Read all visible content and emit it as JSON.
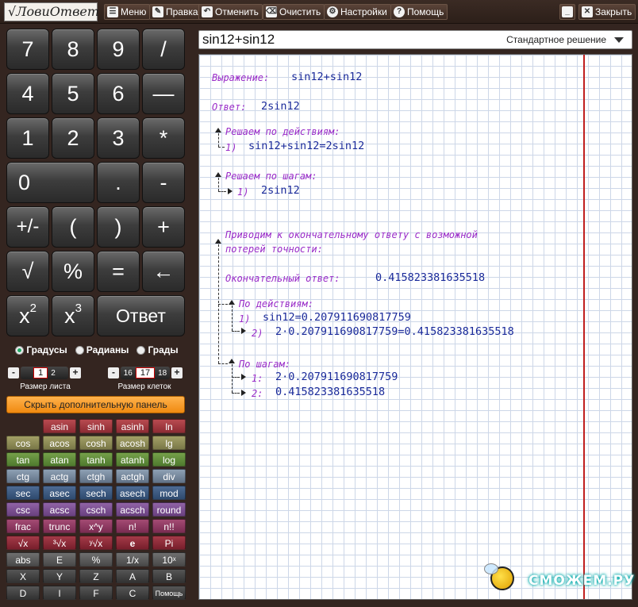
{
  "app": {
    "logo_text": "√ЛовиОтвет"
  },
  "toolbar": {
    "menu": "Меню",
    "edit": "Правка",
    "undo": "Отменить",
    "clear": "Очистить",
    "settings": "Настройки",
    "help": "Помощь",
    "close": "Закрыть"
  },
  "keypad": {
    "k7": "7",
    "k8": "8",
    "k9": "9",
    "kdiv": "/",
    "k4": "4",
    "k5": "5",
    "k6": "6",
    "kdash": "—",
    "k1": "1",
    "k2": "2",
    "k3": "3",
    "kmul": "*",
    "k0": "0",
    "kdot": ".",
    "kminus": "-",
    "kpm": "+/-",
    "klp": "(",
    "krp": ")",
    "kplus": "+",
    "ksqrt": "√",
    "kpct": "%",
    "keq": "=",
    "kback": "←",
    "kx": "x",
    "kx2sup": "2",
    "kx3sup": "3",
    "kanswer": "Ответ"
  },
  "angle_units": {
    "degrees": "Градусы",
    "radians": "Радианы",
    "grads": "Грады",
    "selected": "degrees"
  },
  "sheet_size": {
    "label": "Размер листа",
    "current": "1",
    "next": "2"
  },
  "cell_size": {
    "label": "Размер клеток",
    "prev": "16",
    "current": "17",
    "next": "18"
  },
  "hide_panel_button": "Скрыть дополнительную панель",
  "functions": {
    "asin": "asin",
    "sinh": "sinh",
    "asinh": "asinh",
    "ln": "ln",
    "cos": "cos",
    "acos": "acos",
    "cosh": "cosh",
    "acosh": "acosh",
    "lg": "lg",
    "tan": "tan",
    "atan": "atan",
    "tanh": "tanh",
    "atanh": "atanh",
    "log": "log",
    "ctg": "ctg",
    "actg": "actg",
    "ctgh": "ctgh",
    "actgh": "actgh",
    "div": "div",
    "sec": "sec",
    "asec": "asec",
    "sech": "sech",
    "asech": "asech",
    "mod": "mod",
    "csc": "csc",
    "acsc": "acsc",
    "csch": "csch",
    "acsch": "acsch",
    "round": "round",
    "frac": "frac",
    "trunc": "trunc",
    "xpowy": "x^y",
    "fact": "n!",
    "dfact": "n!!",
    "sqrtx": "√x",
    "cbrtx": "³√x",
    "yrootx": "ʸ√x",
    "e": "e",
    "pi": "Pi",
    "abs": "abs",
    "E": "E",
    "percent": "%",
    "inv": "1/x",
    "tenx": "10ˣ",
    "X": "X",
    "Y": "Y",
    "Z": "Z",
    "A": "A",
    "B": "B",
    "D": "D",
    "I": "I",
    "F": "F",
    "C": "C",
    "help": "Помощь"
  },
  "input": {
    "expression": "sin12+sin12",
    "mode": "Стандартное решение"
  },
  "solution": {
    "expr_label": "Выражение:",
    "expr_value": "sin12+sin12",
    "answer_label": "Ответ:",
    "answer_value": "2sin12",
    "by_actions_label": "Решаем по действиям:",
    "by_actions_step1": "1)",
    "by_actions_step1_value": "sin12+sin12=2sin12",
    "by_steps_label": "Решаем по шагам:",
    "by_steps_step1": "1)",
    "by_steps_step1_value": "2sin12",
    "final_intro_1": "Приводим к окончательному ответу с возможной",
    "final_intro_2": "потерей точности:",
    "final_label": "Окончательный ответ:",
    "final_value": "0.415823381635518",
    "fa_label": "По действиям:",
    "fa_step1": "1)",
    "fa_step1_value": "sin12=0.207911690817759",
    "fa_step2": "2)",
    "fa_step2_value": "2·0.207911690817759=0.415823381635518",
    "fs_label": "По шагам:",
    "fs_step1": "1:",
    "fs_step1_value": "2·0.207911690817759",
    "fs_step2": "2:",
    "fs_step2_value": "0.415823381635518"
  },
  "watermark": {
    "text": "СМОЖЕМ.РУ"
  }
}
